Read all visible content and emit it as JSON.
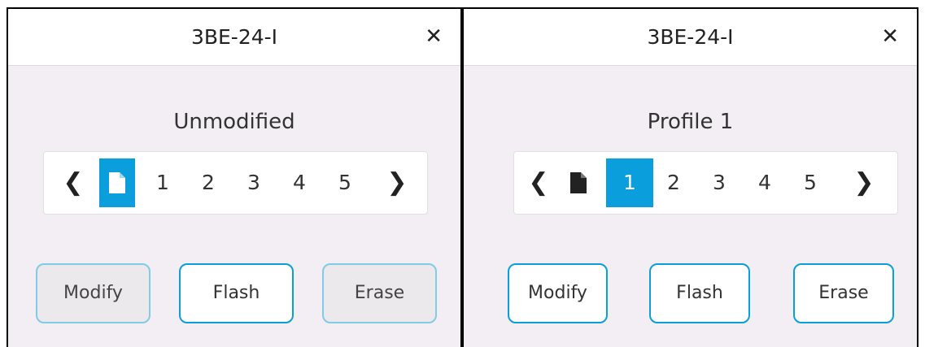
{
  "left_dialog": {
    "title": "3BE-24-I",
    "close_symbol": "✕",
    "status": "Unmodified",
    "pager": {
      "prev": "❮",
      "next": "❯",
      "pages": [
        "1",
        "2",
        "3",
        "4",
        "5"
      ],
      "active": "file"
    },
    "buttons": {
      "modify": "Modify",
      "flash": "Flash",
      "erase": "Erase"
    }
  },
  "right_dialog": {
    "title": "3BE-24-I",
    "close_symbol": "✕",
    "status": "Profile 1",
    "pager": {
      "prev": "❮",
      "next": "❯",
      "pages": [
        "1",
        "2",
        "3",
        "4",
        "5"
      ],
      "active": "1"
    },
    "buttons": {
      "modify": "Modify",
      "flash": "Flash",
      "erase": "Erase"
    }
  },
  "colors": {
    "accent": "#0a9fdc",
    "panel_bg": "#f3eef3",
    "disabled_bg": "#ebe9eb"
  }
}
